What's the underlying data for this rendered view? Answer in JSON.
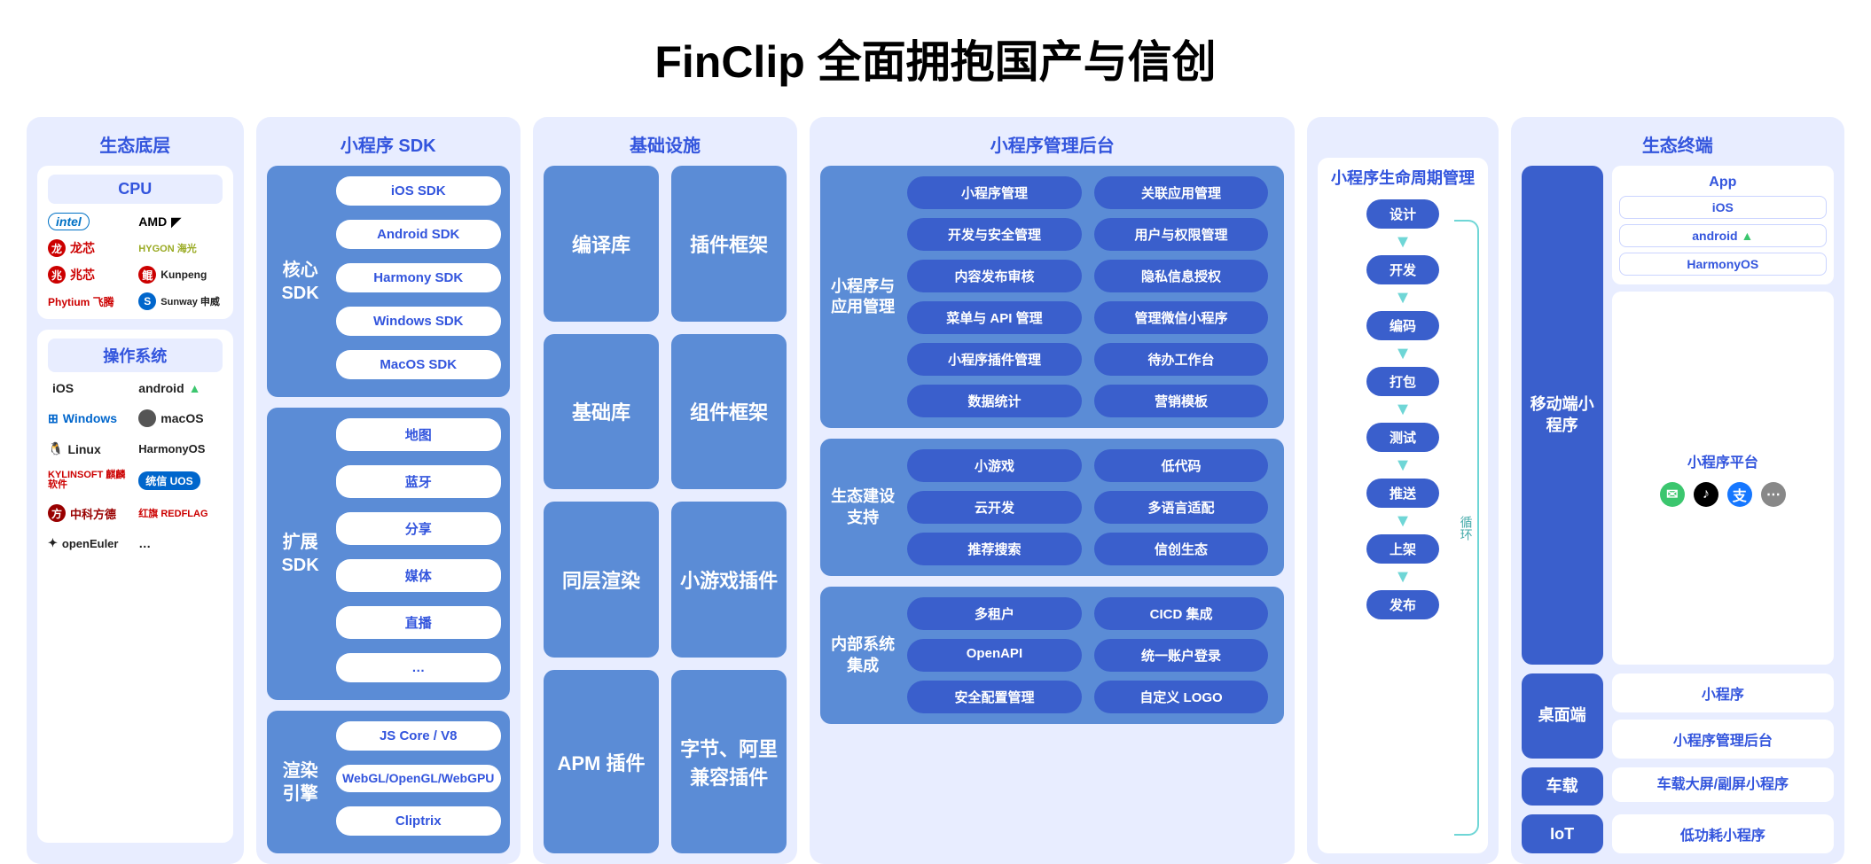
{
  "title": "FinClip 全面拥抱国产与信创",
  "columns": {
    "eco_base": {
      "header": "生态底层",
      "cpu": {
        "header": "CPU",
        "logos": [
          "intel",
          "AMD",
          "龙芯",
          "HYGON 海光",
          "兆芯",
          "Kunpeng",
          "Phytium 飞腾",
          "Sunway 申威"
        ]
      },
      "os": {
        "header": "操作系统",
        "logos": [
          "iOS",
          "android",
          "Windows",
          "macOS",
          "Linux",
          "HarmonyOS",
          "KYLINSOFT 麒麟软件",
          "统信 UOS",
          "中科方德",
          "红旗 REDFLAG",
          "openEuler",
          "…"
        ]
      }
    },
    "sdk": {
      "header": "小程序 SDK",
      "core": {
        "label": "核心 SDK",
        "items": [
          "iOS SDK",
          "Android SDK",
          "Harmony SDK",
          "Windows SDK",
          "MacOS SDK"
        ]
      },
      "ext": {
        "label": "扩展 SDK",
        "items": [
          "地图",
          "蓝牙",
          "分享",
          "媒体",
          "直播",
          "…"
        ]
      },
      "render": {
        "label": "渲染 引擎",
        "items": [
          "JS Core / V8",
          "WebGL/OpenGL/WebGPU",
          "Cliptrix"
        ]
      }
    },
    "infra": {
      "header": "基础设施",
      "boxes": [
        "编译库",
        "插件框架",
        "基础库",
        "组件框架",
        "同层渲染",
        "小游戏插件",
        "APM 插件",
        "字节、阿里兼容插件"
      ]
    },
    "mgmt": {
      "header": "小程序管理后台",
      "app_mgmt": {
        "label": "小程序与应用管理",
        "items": [
          "小程序管理",
          "关联应用管理",
          "开发与安全管理",
          "用户与权限管理",
          "内容发布审核",
          "隐私信息授权",
          "菜单与 API 管理",
          "管理微信小程序",
          "小程序插件管理",
          "待办工作台",
          "数据统计",
          "营销模板"
        ]
      },
      "eco_build": {
        "label": "生态建设支持",
        "items": [
          "小游戏",
          "低代码",
          "云开发",
          "多语言适配",
          "推荐搜索",
          "信创生态"
        ]
      },
      "internal": {
        "label": "内部系统集成",
        "items": [
          "多租户",
          "CICD 集成",
          "OpenAPI",
          "统一账户登录",
          "安全配置管理",
          "自定义 LOGO"
        ]
      }
    },
    "lifecycle": {
      "header": "小程序生命周期管理",
      "steps": [
        "设计",
        "开发",
        "编码",
        "打包",
        "测试",
        "推送",
        "上架",
        "发布"
      ],
      "loop": "循环"
    },
    "terminal": {
      "header": "生态终端",
      "mobile": {
        "label": "移动端小程序",
        "app": {
          "header": "App",
          "os": [
            "iOS",
            "android",
            "HarmonyOS"
          ]
        },
        "platform": {
          "header": "小程序平台",
          "icons": [
            "wechat",
            "tiktok",
            "alipay",
            "more"
          ]
        }
      },
      "desktop": {
        "label": "桌面端",
        "items": [
          "小程序",
          "小程序管理后台"
        ]
      },
      "car": {
        "label": "车载",
        "items": [
          "车载大屏/副屏小程序"
        ]
      },
      "iot": {
        "label": "IoT",
        "items": [
          "低功耗小程序"
        ]
      }
    }
  }
}
